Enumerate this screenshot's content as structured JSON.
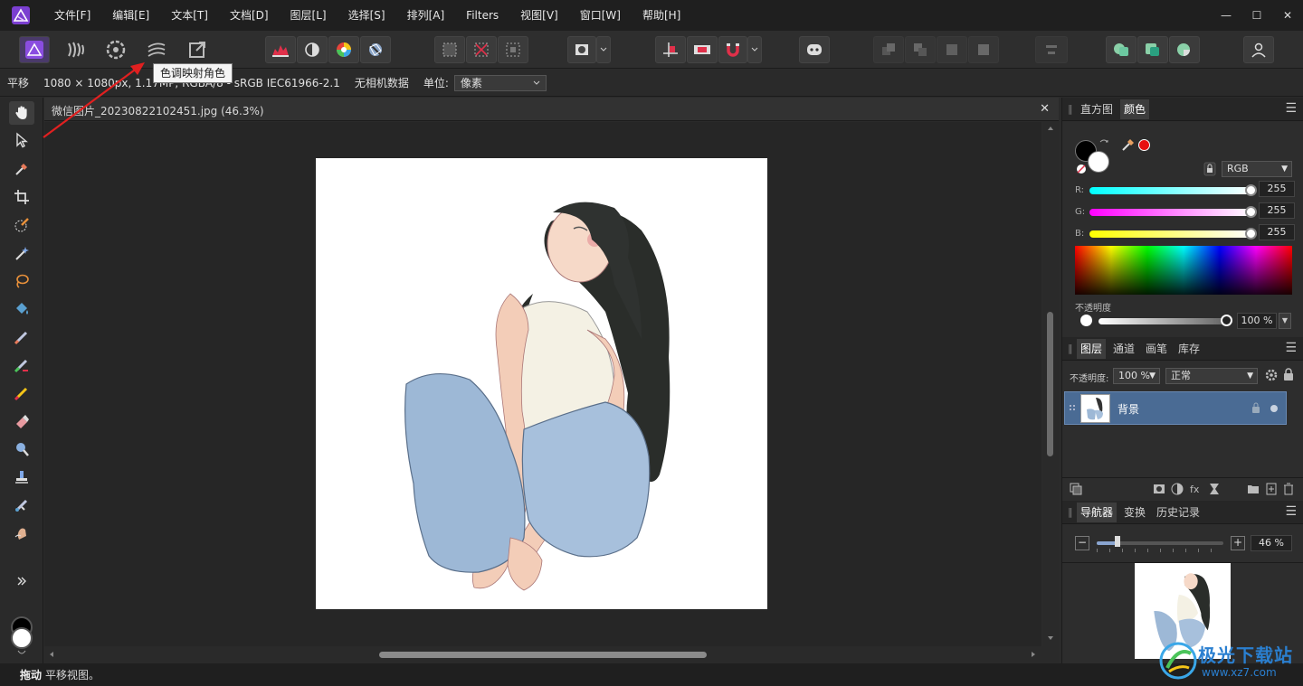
{
  "menu": {
    "items": [
      "文件[F]",
      "编辑[E]",
      "文本[T]",
      "文档[D]",
      "图层[L]",
      "选择[S]",
      "排列[A]",
      "Filters",
      "视图[V]",
      "窗口[W]",
      "帮助[H]"
    ]
  },
  "window": {
    "minimize": "—",
    "maximize": "☐",
    "close": "✕"
  },
  "tooltip": "色调映射角色",
  "context": {
    "tool_name": "平移",
    "image_info": "1080 × 1080px, 1.17MP, RGBA/8 - sRGB IEC61966-2.1",
    "camera": "无相机数据",
    "unit_label": "单位:",
    "unit_value": "像素"
  },
  "document": {
    "title": "微信图片_20230822102451.jpg (46.3%)",
    "close": "✕"
  },
  "status": {
    "bold": "拖动",
    "text": "平移视图。"
  },
  "colors_panel": {
    "tabs": [
      "直方图",
      "颜色"
    ],
    "active_tab": "颜色",
    "mode": "RGB",
    "r_label": "R:",
    "g_label": "G:",
    "b_label": "B:",
    "r": "255",
    "g": "255",
    "b": "255",
    "opacity_label": "不透明度",
    "opacity": "100 %"
  },
  "layers_panel": {
    "tabs": [
      "图层",
      "通道",
      "画笔",
      "库存"
    ],
    "active_tab": "图层",
    "opacity_label": "不透明度:",
    "opacity": "100 %",
    "blend_mode": "正常",
    "layer_name": "背景"
  },
  "navigator_panel": {
    "tabs": [
      "导航器",
      "变换",
      "历史记录"
    ],
    "active_tab": "导航器",
    "zoom": "46 %"
  },
  "watermark": {
    "title": "极光下载站",
    "url": "www.xz7.com"
  },
  "colors": {
    "accent": "#4a6b94",
    "annotation_arrow": "#e02020",
    "brand": "#7b3fd1"
  }
}
